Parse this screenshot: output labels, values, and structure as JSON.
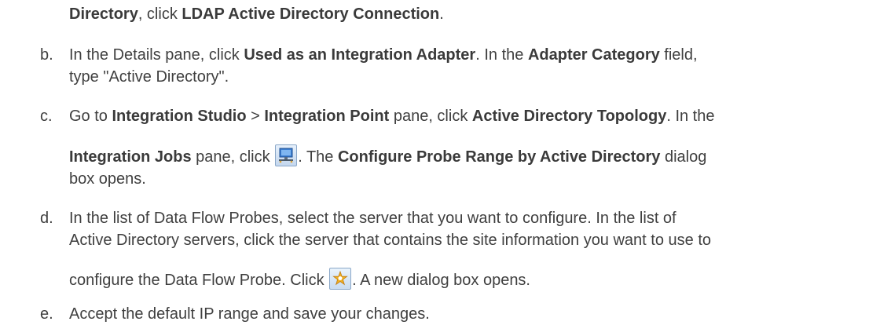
{
  "step_a_cont": {
    "b1": "Directory",
    "t1": ", click ",
    "b2": "LDAP Active Directory Connection",
    "t2": "."
  },
  "step_b": {
    "marker": "b.",
    "l1": {
      "t1": "In the Details pane, click ",
      "b1": "Used as an Integration Adapter",
      "t2": ". In the ",
      "b2": "Adapter Category",
      "t3": " field,"
    },
    "l2": {
      "t1": "type \"Active Directory\"."
    }
  },
  "step_c": {
    "marker": "c.",
    "l1": {
      "t1": "Go to ",
      "b1": "Integration Studio",
      "t2": " > ",
      "b2": "Integration Point",
      "t3": " pane, click ",
      "b3": "Active Directory Topology",
      "t4": ". In the"
    },
    "l2": {
      "b1": "Integration Jobs",
      "t1": " pane, click ",
      "t2": ". The ",
      "b2": "Configure Probe Range by Active Directory",
      "t3": " dialog"
    },
    "l3": {
      "t1": "box opens."
    }
  },
  "step_d": {
    "marker": "d.",
    "l1": {
      "t1": "In the list of Data Flow Probes, select the server that you want to configure. In the list of"
    },
    "l2": {
      "t1": "Active Directory servers, click the server that contains the site information you want to use to"
    },
    "l3": {
      "t1": "configure the Data Flow Probe. Click ",
      "t2": ". A new dialog box opens."
    }
  },
  "step_e": {
    "marker": "e.",
    "l1": {
      "t1": "Accept the default IP range and save your changes."
    }
  },
  "icons": {
    "c_icon": "configure-probe-range-icon",
    "d_icon": "new-star-icon"
  }
}
